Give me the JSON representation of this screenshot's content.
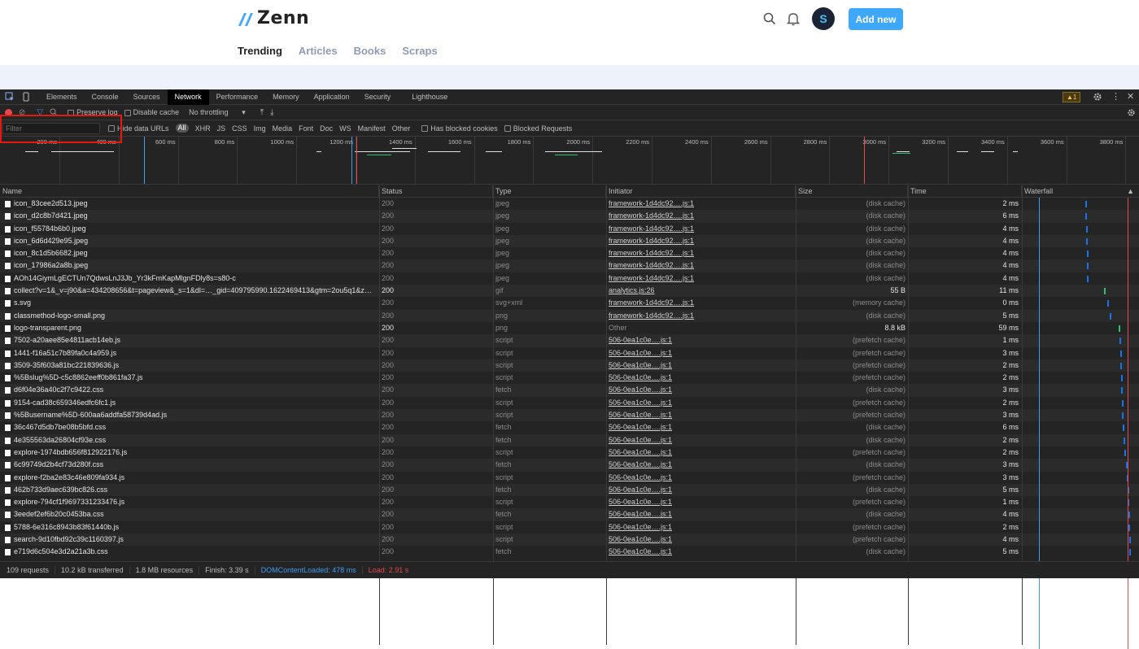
{
  "site": {
    "logo_text": "Zenn",
    "avatar_letter": "S",
    "add_new": "Add new",
    "tabs": [
      "Trending",
      "Articles",
      "Books",
      "Scraps"
    ]
  },
  "devtools": {
    "tabs": [
      "Elements",
      "Console",
      "Sources",
      "Network",
      "Performance",
      "Memory",
      "Application",
      "Security",
      "Lighthouse"
    ],
    "active_tab": "Network",
    "warning_count": "1",
    "toolbar": {
      "preserve_log": "Preserve log",
      "disable_cache": "Disable cache",
      "throttling": "No throttling"
    },
    "filter": {
      "placeholder": "Filter",
      "hide_data_urls": "Hide data URLs",
      "types": [
        "All",
        "XHR",
        "JS",
        "CSS",
        "Img",
        "Media",
        "Font",
        "Doc",
        "WS",
        "Manifest",
        "Other"
      ],
      "has_blocked_cookies": "Has blocked cookies",
      "blocked_requests": "Blocked Requests"
    },
    "overview_ticks": [
      "200 ms",
      "400 ms",
      "600 ms",
      "800 ms",
      "1000 ms",
      "1200 ms",
      "1400 ms",
      "1600 ms",
      "1800 ms",
      "2000 ms",
      "2200 ms",
      "2400 ms",
      "2600 ms",
      "2800 ms",
      "3000 ms",
      "3200 ms",
      "3400 ms",
      "3600 ms",
      "3800 ms"
    ],
    "columns": [
      "Name",
      "Status",
      "Type",
      "Initiator",
      "Size",
      "Time",
      "Waterfall"
    ],
    "rows": [
      {
        "name": "icon_83cee2d513.jpeg",
        "status": "200",
        "type": "jpeg",
        "initiator": "framework-1d4dc92….js:1",
        "size": "(disk cache)",
        "time": "2 ms"
      },
      {
        "name": "icon_d2c8b7d421.jpeg",
        "status": "200",
        "type": "jpeg",
        "initiator": "framework-1d4dc92….js:1",
        "size": "(disk cache)",
        "time": "6 ms"
      },
      {
        "name": "icon_f55784b6b0.jpeg",
        "status": "200",
        "type": "jpeg",
        "initiator": "framework-1d4dc92….js:1",
        "size": "(disk cache)",
        "time": "4 ms"
      },
      {
        "name": "icon_6d6d429e95.jpeg",
        "status": "200",
        "type": "jpeg",
        "initiator": "framework-1d4dc92….js:1",
        "size": "(disk cache)",
        "time": "4 ms"
      },
      {
        "name": "icon_8c1d5b6682.jpeg",
        "status": "200",
        "type": "jpeg",
        "initiator": "framework-1d4dc92….js:1",
        "size": "(disk cache)",
        "time": "4 ms"
      },
      {
        "name": "icon_17986a2a8b.jpeg",
        "status": "200",
        "type": "jpeg",
        "initiator": "framework-1d4dc92….js:1",
        "size": "(disk cache)",
        "time": "4 ms"
      },
      {
        "name": "AOh14GiymLgECTUn7QdwsLnJ3Jb_Yr3kFmKapMlgnFDly8s=s80-c",
        "status": "200",
        "type": "jpeg",
        "initiator": "framework-1d4dc92….js:1",
        "size": "(disk cache)",
        "time": "4 ms"
      },
      {
        "name": "collect?v=1&_v=j90&a=434208656&t=pageview&_s=1&dl=…_gid=409795990.1622469413&gtm=2ou5q1&z=20…",
        "status": "200",
        "type": "gif",
        "initiator": "analytics.js:26",
        "size": "55 B",
        "time": "11 ms",
        "bright": true
      },
      {
        "name": "s.svg",
        "status": "200",
        "type": "svg+xml",
        "initiator": "framework-1d4dc92….js:1",
        "size": "(memory cache)",
        "time": "0 ms"
      },
      {
        "name": "classmethod-logo-small.png",
        "status": "200",
        "type": "png",
        "initiator": "framework-1d4dc92….js:1",
        "size": "(disk cache)",
        "time": "5 ms"
      },
      {
        "name": "logo-transparent.png",
        "status": "200",
        "type": "png",
        "initiator": "Other",
        "size": "8.8 kB",
        "time": "59 ms",
        "bright": true,
        "plain_init": true
      },
      {
        "name": "7502-a20aee85e4811acb14eb.js",
        "status": "200",
        "type": "script",
        "initiator": "506-0ea1c0e….js:1",
        "size": "(prefetch cache)",
        "time": "1 ms"
      },
      {
        "name": "1441-f16a51c7b89fa0c4a959.js",
        "status": "200",
        "type": "script",
        "initiator": "506-0ea1c0e….js:1",
        "size": "(prefetch cache)",
        "time": "3 ms"
      },
      {
        "name": "3509-35f603a81bc221839636.js",
        "status": "200",
        "type": "script",
        "initiator": "506-0ea1c0e….js:1",
        "size": "(prefetch cache)",
        "time": "2 ms"
      },
      {
        "name": "%5Bslug%5D-c5c8862eeff0b861fa37.js",
        "status": "200",
        "type": "script",
        "initiator": "506-0ea1c0e….js:1",
        "size": "(prefetch cache)",
        "time": "2 ms"
      },
      {
        "name": "d6f04e36a40c2f7c9422.css",
        "status": "200",
        "type": "fetch",
        "initiator": "506-0ea1c0e….js:1",
        "size": "(disk cache)",
        "time": "3 ms"
      },
      {
        "name": "9154-cad38c659346edfc6fc1.js",
        "status": "200",
        "type": "script",
        "initiator": "506-0ea1c0e….js:1",
        "size": "(prefetch cache)",
        "time": "2 ms"
      },
      {
        "name": "%5Busername%5D-600aa6addfa58739d4ad.js",
        "status": "200",
        "type": "script",
        "initiator": "506-0ea1c0e….js:1",
        "size": "(prefetch cache)",
        "time": "3 ms"
      },
      {
        "name": "36c467d5db7be08b5bfd.css",
        "status": "200",
        "type": "fetch",
        "initiator": "506-0ea1c0e….js:1",
        "size": "(disk cache)",
        "time": "6 ms"
      },
      {
        "name": "4e355563da26804cf93e.css",
        "status": "200",
        "type": "fetch",
        "initiator": "506-0ea1c0e….js:1",
        "size": "(disk cache)",
        "time": "2 ms"
      },
      {
        "name": "explore-1974bdb656f812922176.js",
        "status": "200",
        "type": "script",
        "initiator": "506-0ea1c0e….js:1",
        "size": "(prefetch cache)",
        "time": "2 ms"
      },
      {
        "name": "6c99749d2b4cf73d280f.css",
        "status": "200",
        "type": "fetch",
        "initiator": "506-0ea1c0e….js:1",
        "size": "(disk cache)",
        "time": "3 ms"
      },
      {
        "name": "explore-f2ba2e83c46e809fa934.js",
        "status": "200",
        "type": "script",
        "initiator": "506-0ea1c0e….js:1",
        "size": "(prefetch cache)",
        "time": "3 ms"
      },
      {
        "name": "462b733d9aec639bc826.css",
        "status": "200",
        "type": "fetch",
        "initiator": "506-0ea1c0e….js:1",
        "size": "(disk cache)",
        "time": "5 ms"
      },
      {
        "name": "explore-794cf1f9697331233476.js",
        "status": "200",
        "type": "script",
        "initiator": "506-0ea1c0e….js:1",
        "size": "(prefetch cache)",
        "time": "1 ms"
      },
      {
        "name": "3eedef2ef6b20c0453ba.css",
        "status": "200",
        "type": "fetch",
        "initiator": "506-0ea1c0e….js:1",
        "size": "(disk cache)",
        "time": "4 ms"
      },
      {
        "name": "5788-6e316c8943b83f61440b.js",
        "status": "200",
        "type": "script",
        "initiator": "506-0ea1c0e….js:1",
        "size": "(prefetch cache)",
        "time": "2 ms"
      },
      {
        "name": "search-9d10fbd92c39c1160397.js",
        "status": "200",
        "type": "script",
        "initiator": "506-0ea1c0e….js:1",
        "size": "(prefetch cache)",
        "time": "4 ms"
      },
      {
        "name": "e719d6c504e3d2a21a3b.css",
        "status": "200",
        "type": "fetch",
        "initiator": "506-0ea1c0e….js:1",
        "size": "(disk cache)",
        "time": "5 ms"
      }
    ],
    "status_bar": {
      "requests": "109 requests",
      "transferred": "10.2 kB transferred",
      "resources": "1.8 MB resources",
      "finish": "Finish: 3.39 s",
      "dcl": "DOMContentLoaded: 478 ms",
      "load": "Load: 2.91 s"
    },
    "colors": {
      "dcl": "#3d9bf4",
      "load": "#e5484d",
      "accent": "#3ea8ff"
    }
  }
}
